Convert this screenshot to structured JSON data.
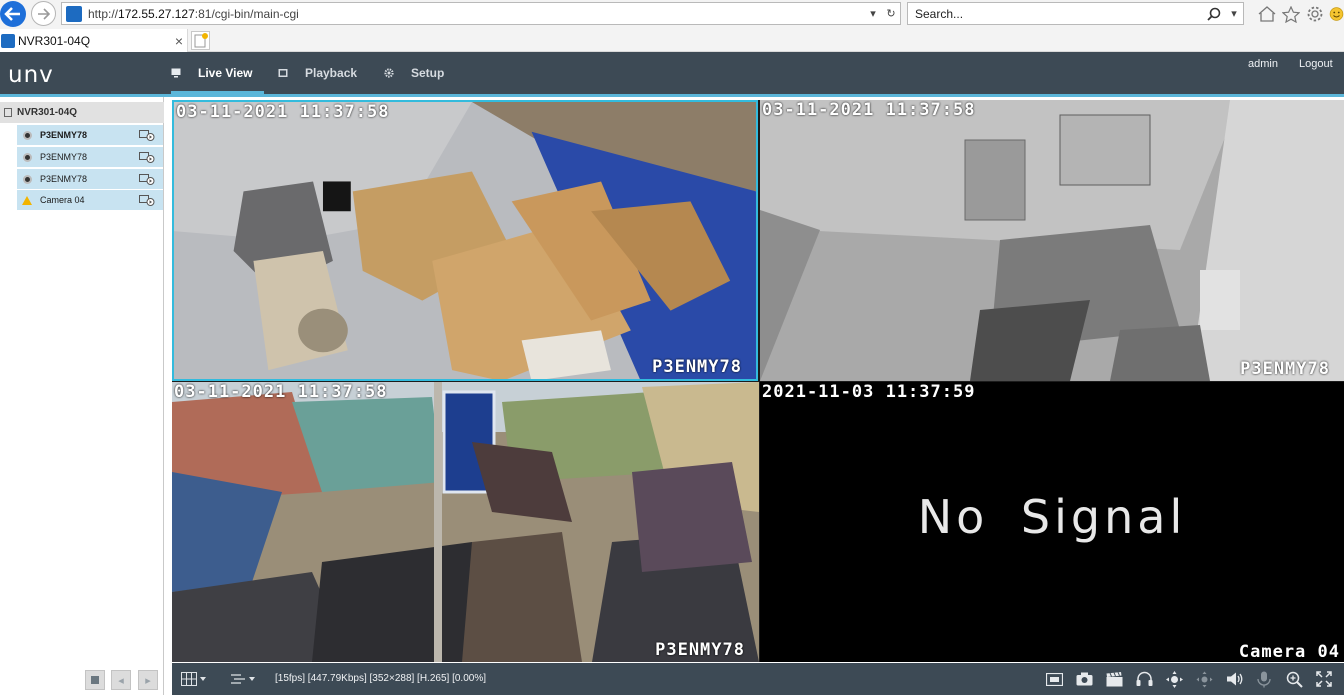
{
  "browser": {
    "address": {
      "prefix": "http://",
      "host": "172.55.27.127",
      "path": ":81/cgi-bin/main-cgi"
    },
    "search_placeholder": "Search...",
    "tab_title": "NVR301-04Q",
    "icons": [
      "back-icon",
      "forward-icon",
      "refresh-icon",
      "search-icon",
      "home-icon",
      "star-icon",
      "gear-icon",
      "smiley-icon"
    ]
  },
  "app": {
    "logo": "unv",
    "tabs": [
      {
        "label": "Live View",
        "icon": "monitor-icon",
        "active": true
      },
      {
        "label": "Playback",
        "icon": "film-icon",
        "active": false
      },
      {
        "label": "Setup",
        "icon": "gear-icon",
        "active": false
      }
    ],
    "user": "admin",
    "logout": "Logout",
    "accent": "#5bb6d9",
    "header_bg": "#3d4a55"
  },
  "sidebar": {
    "root": "NVR301-04Q",
    "items": [
      {
        "label": "P3ENMY78",
        "status": "online",
        "selected": true
      },
      {
        "label": "P3ENMY78",
        "status": "online",
        "selected": false
      },
      {
        "label": "P3ENMY78",
        "status": "online",
        "selected": false
      },
      {
        "label": "Camera 04",
        "status": "warning",
        "selected": false
      }
    ]
  },
  "views": [
    {
      "timestamp": "03-11-2021 11:37:58",
      "name": "P3ENMY78",
      "selected": true
    },
    {
      "timestamp": "03-11-2021 11:37:58",
      "name": "P3ENMY78",
      "selected": false
    },
    {
      "timestamp": "03-11-2021 11:37:58",
      "name": "P3ENMY78",
      "selected": false
    },
    {
      "timestamp": "2021-11-03 11:37:59",
      "name": "Camera 04",
      "message": "No Signal",
      "selected": false
    }
  ],
  "toolbar": {
    "status": "[15fps] [447.79Kbps] [352×288] [H.265] [0.00%]"
  }
}
